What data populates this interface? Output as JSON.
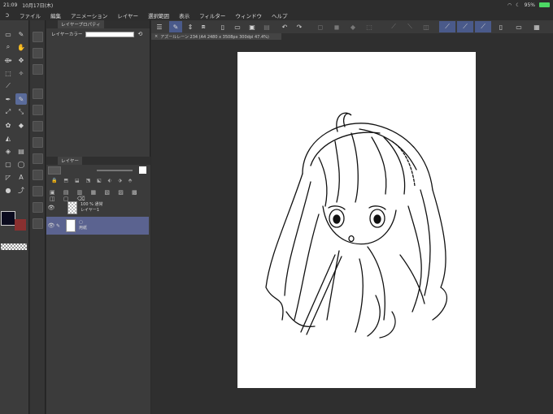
{
  "status": {
    "time": "21:09",
    "date": "10月17日(木)",
    "battery_pct": "95%"
  },
  "menu": {
    "items": [
      "ファイル",
      "編集",
      "アニメーション",
      "レイヤー",
      "選択範囲",
      "表示",
      "フィルター",
      "ウィンドウ",
      "ヘルプ"
    ]
  },
  "panels": {
    "property_tab": "レイヤープロパティ",
    "layer_color_label": "レイヤーカラー",
    "layer_tab": "レイヤー"
  },
  "layers": [
    {
      "opacity_blend": "100 % 通常",
      "name": "レイヤー1",
      "selected": false
    },
    {
      "name": "用紙",
      "selected": true
    }
  ],
  "canvas": {
    "doc_title": "アズールレーン 234 (A4 2480 x 3508px 300dpi 47.4%)"
  },
  "colors": {
    "accent": "#5b6390",
    "primary_color": "#0b0b1e",
    "secondary_color": "#8a3030"
  }
}
